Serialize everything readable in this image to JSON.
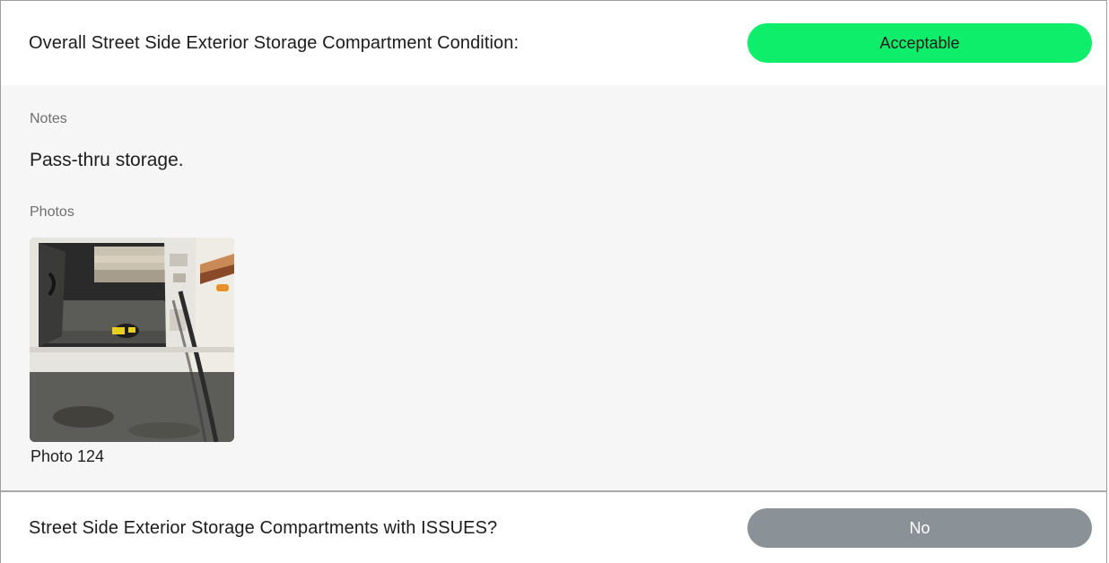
{
  "sections": [
    {
      "question": "Overall Street Side Exterior Storage Compartment Condition:",
      "answer": "Acceptable",
      "answer_color": "#0eee6a"
    },
    {
      "question": "Street Side Exterior Storage Compartments with ISSUES?",
      "answer": "No",
      "answer_color": "#8a9197"
    }
  ],
  "details": {
    "notes_label": "Notes",
    "notes_text": "Pass-thru storage.",
    "photos_label": "Photos",
    "photos": [
      {
        "caption": "Photo 124",
        "icon": "rv-storage-compartment-photo"
      }
    ]
  }
}
